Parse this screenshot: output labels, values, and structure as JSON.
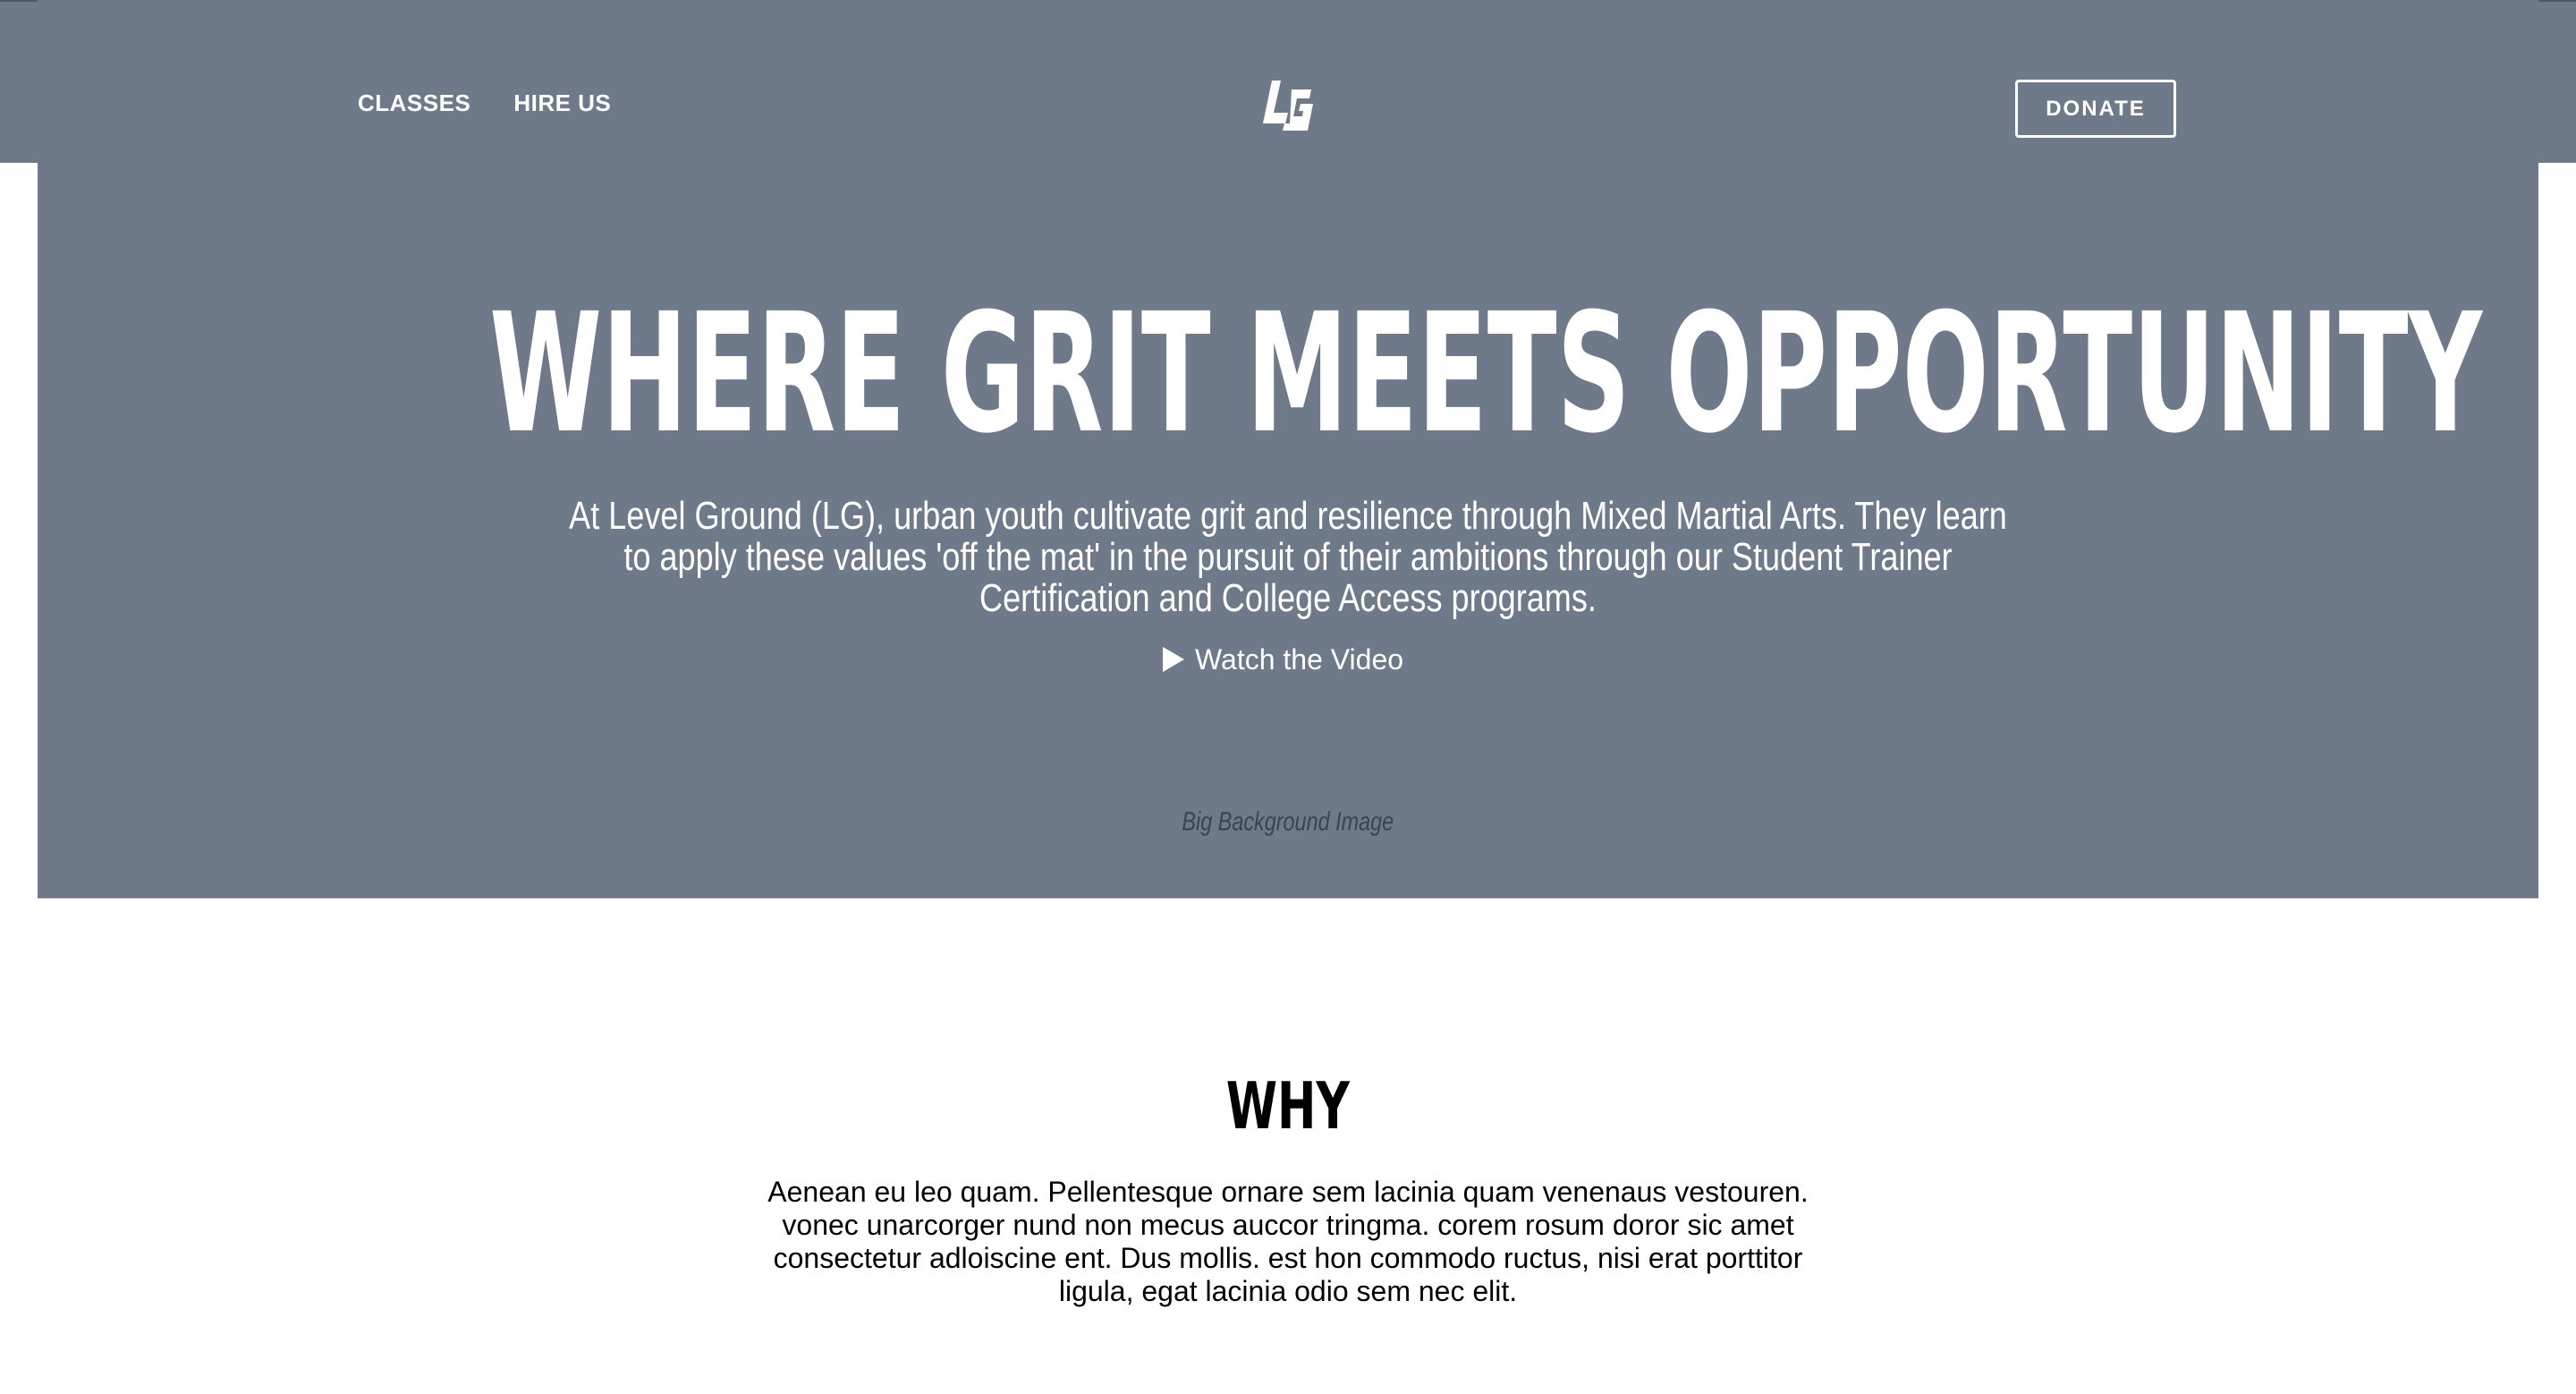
{
  "header": {
    "nav": [
      {
        "label": "CLASSES"
      },
      {
        "label": "HIRE US"
      }
    ],
    "logo_text": "LG",
    "donate_label": "DONATE"
  },
  "hero": {
    "title": "WHERE GRIT MEETS OPPORTUNITY",
    "subtitle": "At Level Ground (LG), urban youth cultivate grit and resilience through Mixed Martial Arts. They learn to apply these values 'off the mat' in the pursuit of their ambitions through our Student Trainer Certification and College Access programs.",
    "watch_video_label": "Watch the Video",
    "background_caption": "Big Background Image"
  },
  "why": {
    "title": "WHY",
    "body": "Aenean eu leo quam. Pellentesque ornare sem lacinia quam venenaus vestouren. vonec unarcorger nund non mecus auccor tringma. corem rosum doror sic amet consectetur adloiscine ent. Dus mollis. est hon commodo ructus, nisi erat porttitor ligula, egat lacinia odio sem nec elit."
  },
  "colors": {
    "hero_background": "#6e7a8a",
    "text_light": "#ffffff",
    "caption": "#3b4451"
  },
  "icons": {
    "play": "play-icon",
    "logo": "lg-logo-icon"
  }
}
